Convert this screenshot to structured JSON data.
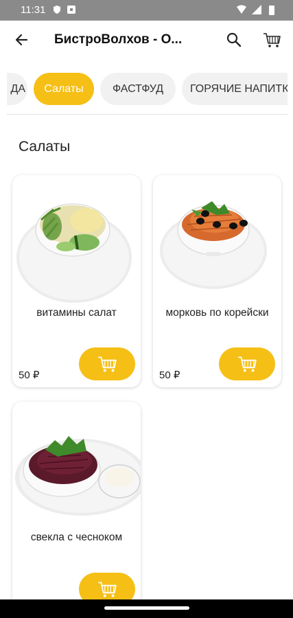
{
  "status_bar": {
    "time": "11:31"
  },
  "app_bar": {
    "title": "БистроВолхов - О...",
    "back_icon": "arrow-left-icon",
    "search_icon": "search-icon",
    "cart_icon": "cart-icon"
  },
  "tabs": [
    {
      "label": "ДА",
      "active": false
    },
    {
      "label": "Салаты",
      "active": true
    },
    {
      "label": "ФАСТФУД",
      "active": false
    },
    {
      "label": "ГОРЯЧИЕ НАПИТКИ",
      "active": false
    }
  ],
  "section": {
    "title": "Салаты"
  },
  "products": [
    {
      "name": "витамины салат",
      "price": "50 ₽"
    },
    {
      "name": "морковь по корейски",
      "price": "50 ₽"
    },
    {
      "name": "свекла с чесноком",
      "price": ""
    }
  ],
  "colors": {
    "accent": "#f5bf16",
    "status_bar": "#8a8a8a",
    "tab_bg": "#f1f1f1"
  }
}
